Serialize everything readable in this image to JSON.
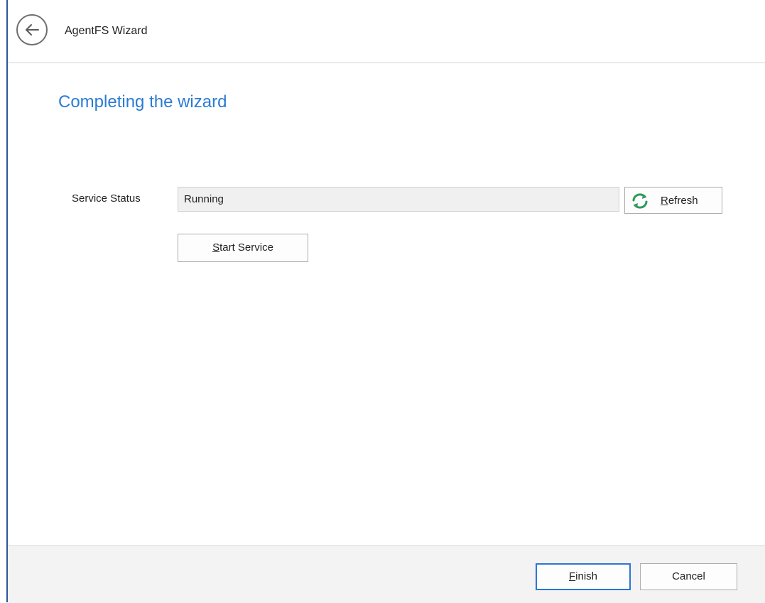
{
  "header": {
    "title": "AgentFS Wizard",
    "back_icon": "back-arrow-icon"
  },
  "page": {
    "heading": "Completing the wizard"
  },
  "service": {
    "status_label": "Service Status",
    "status_value": "Running",
    "refresh_label_mnemonic": "R",
    "refresh_label_rest": "efresh",
    "refresh_icon": "refresh-icon",
    "start_label_mnemonic": "S",
    "start_label_rest": "tart Service"
  },
  "footer": {
    "finish_mnemonic": "F",
    "finish_rest": "inish",
    "cancel_label": "Cancel"
  },
  "colors": {
    "accent": "#2b7bd4",
    "refresh_icon": "#2e9a5b",
    "left_edge": "#2b5797"
  }
}
